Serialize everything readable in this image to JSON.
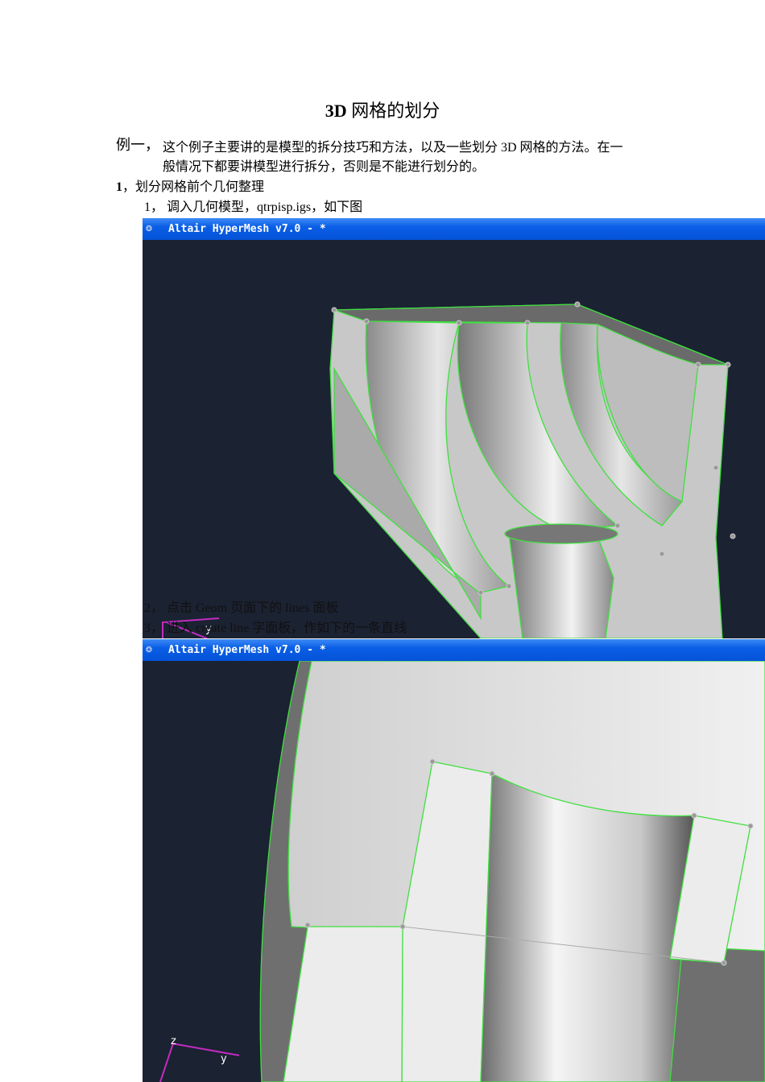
{
  "title": {
    "bold": "3D",
    "rest": " 网格的划分"
  },
  "intro": {
    "label": "例一，",
    "line1": "这个例子主要讲的是模型的拆分技巧和方法，以及一些划分 3D 网格的方法。在一",
    "line2": "般情况下都要讲模型进行拆分，否则是不能进行划分的。"
  },
  "section1": {
    "num": "1",
    "text": "，划分网格前个几何整理"
  },
  "steps": [
    "1，  调入几何模型，qtrpisp.igs，如下图",
    "2，  点击 Geom 页面下的 lines 面板",
    "3，  进入 create line 字面板，作如下的一条直线"
  ],
  "screenshots": [
    {
      "window_title": "Altair HyperMesh v7.0 - *",
      "axis_labels": [
        "y"
      ]
    },
    {
      "window_title": "Altair HyperMesh v7.0 - *",
      "axis_labels": [
        "z",
        "y"
      ]
    }
  ],
  "colors": {
    "viewport_bg": "#1b2232",
    "edge": "#3ee03e",
    "titlebar": "#0a5ee6"
  }
}
